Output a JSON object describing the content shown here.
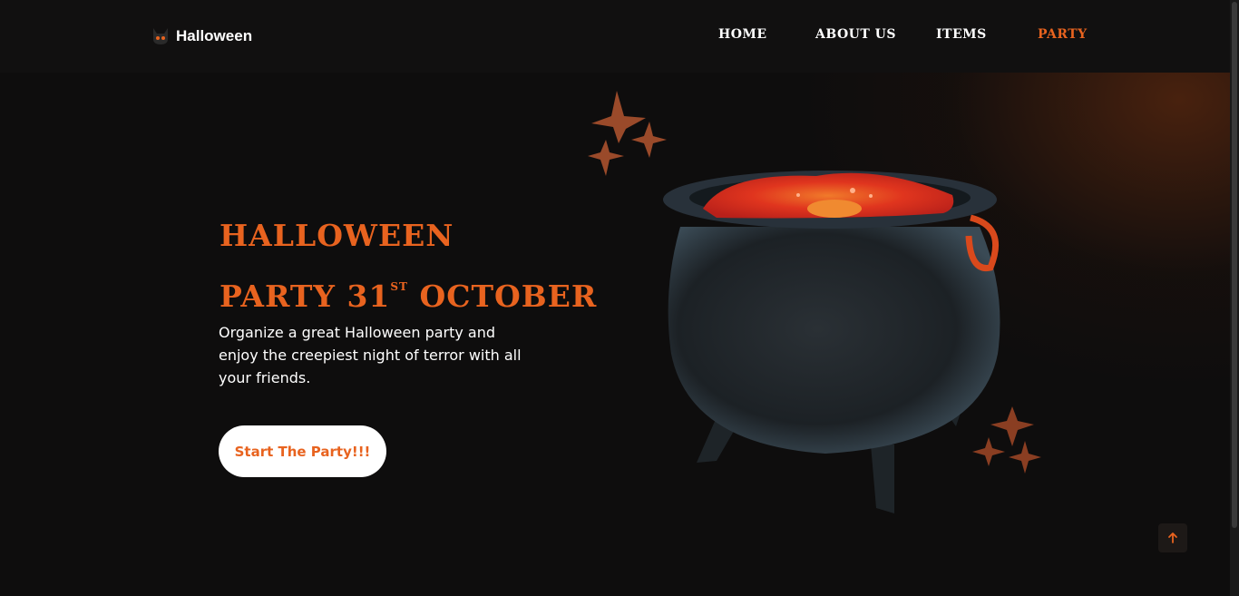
{
  "header": {
    "logo_text": "Halloween",
    "nav": {
      "home": "HOME",
      "about": "ABOUT US",
      "items": "ITEMS",
      "party": "PARTY"
    }
  },
  "hero": {
    "title_line1": "HALLOWEEN",
    "title_line2_prefix": "PARTY 31",
    "title_line2_sup": "ST",
    "title_line2_suffix": " OCTOBER",
    "description": "Organize a great Halloween party and enjoy the creepiest night of terror with all your friends.",
    "cta_label": "Start The Party!!!"
  },
  "icons": {
    "logo": "cat-skull-icon",
    "back_to_top": "arrow-up-icon",
    "decor": "star-icon",
    "image": "cauldron-illustration"
  },
  "colors": {
    "accent": "#e8631f",
    "background": "#0e0d0d",
    "header_bg": "#111010",
    "text": "#ffffff"
  }
}
